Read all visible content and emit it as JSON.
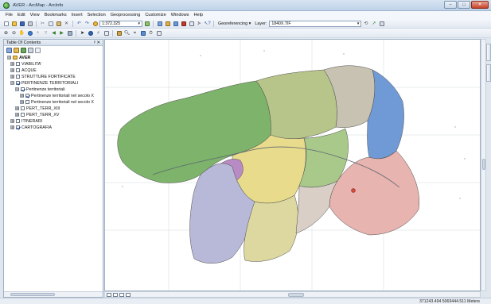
{
  "window": {
    "title": "AVER - ArcMap - ArcInfo",
    "controls": {
      "minimize": "–",
      "maximize": "□",
      "close": "✕"
    }
  },
  "menu": [
    "File",
    "Edit",
    "View",
    "Bookmarks",
    "Insert",
    "Selection",
    "Geoprocessing",
    "Customize",
    "Windows",
    "Help"
  ],
  "toolbar": {
    "scale": "1:372.325",
    "georeferencing_label": "Georeferencing ▾",
    "layer_label": "Layer:",
    "layer_value": "1840X.TIF"
  },
  "icons": {
    "new": "new-document-icon",
    "open": "open-folder-icon",
    "save": "save-icon",
    "print": "print-icon",
    "cut": "cut-icon",
    "copy": "copy-icon",
    "paste": "paste-icon",
    "delete": "delete-icon",
    "undo": "undo-icon",
    "redo": "redo-icon",
    "add_data": "add-data-icon",
    "zoom_in": "zoom-in-icon",
    "zoom_out": "zoom-out-icon",
    "pan": "pan-icon",
    "full_extent": "globe-icon",
    "select": "pointer-icon",
    "identify": "info-icon"
  },
  "toc": {
    "title": "Table Of Contents",
    "close": "✕",
    "pin": "ᵖ",
    "items": [
      {
        "label": "AVER",
        "level": 0,
        "expander": "⊟",
        "checkbox": "none",
        "icon": "dataframe",
        "checked": false
      },
      {
        "label": "VIABILITA'",
        "level": 1,
        "expander": "⊞",
        "checkbox": "show",
        "checked": false
      },
      {
        "label": "ACQUE",
        "level": 1,
        "expander": "⊞",
        "checkbox": "show",
        "checked": false
      },
      {
        "label": "STRUTTURE FORTIFICATE",
        "level": 1,
        "expander": "⊞",
        "checkbox": "show",
        "checked": false
      },
      {
        "label": "PERTINENZE TERRITORIALI",
        "level": 1,
        "expander": "⊟",
        "checkbox": "show",
        "checked": true
      },
      {
        "label": "Pertinenze territoriali",
        "level": 2,
        "expander": "⊟",
        "checkbox": "show",
        "checked": true
      },
      {
        "label": "Pertinenze territoriali nel secolo X",
        "level": 3,
        "expander": "⊞",
        "checkbox": "show",
        "checked": true
      },
      {
        "label": "Pertinenze territoriali nel secolo X",
        "level": 3,
        "expander": "⊞",
        "checkbox": "show",
        "checked": false
      },
      {
        "label": "PERT_TERR_XIII",
        "level": 2,
        "expander": "⊞",
        "checkbox": "show",
        "checked": false
      },
      {
        "label": "PERT_TERR_XV",
        "level": 2,
        "expander": "⊞",
        "checkbox": "show",
        "checked": false
      },
      {
        "label": "ITINERARI",
        "level": 1,
        "expander": "⊞",
        "checkbox": "show",
        "checked": false
      },
      {
        "label": "CARTOGRAFIA",
        "level": 1,
        "expander": "⊞",
        "checkbox": "show",
        "checked": true
      }
    ]
  },
  "status": {
    "coordinates": "371243.494 5069444.511 Meters"
  },
  "colors": {
    "green_region": "#7db36a",
    "blue_region": "#6f9ad6",
    "pink_region": "#e7b4b0",
    "yellow_region": "#e8dc8c",
    "purple_region": "#b98bc4",
    "lavender_region": "#b8b8d8",
    "olive_region": "#b7c58a",
    "gray_region": "#c7c2b2",
    "red_marker": "#d24a3a"
  }
}
